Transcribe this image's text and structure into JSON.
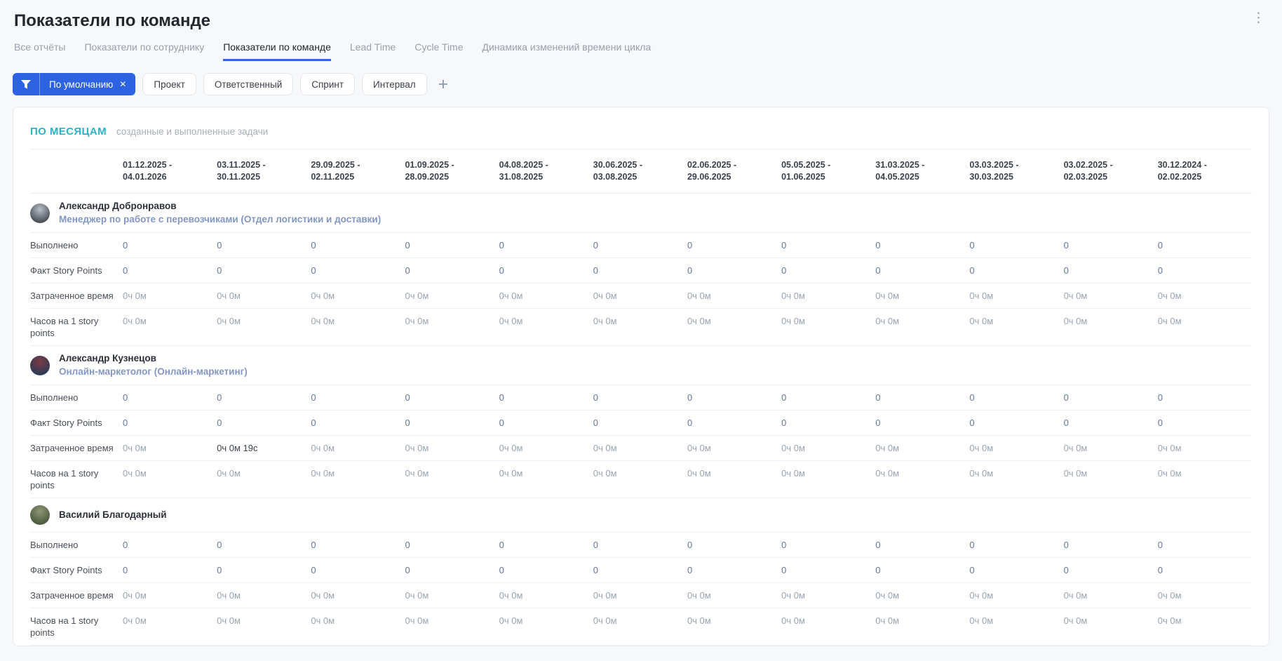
{
  "colors": {
    "accent_blue": "#2d63e2",
    "section_teal": "#2ab3c3"
  },
  "page": {
    "title": "Показатели по команде",
    "kebab_icon": "⋮"
  },
  "tabs": [
    {
      "label": "Все отчёты",
      "active": false
    },
    {
      "label": "Показатели по сотруднику",
      "active": false
    },
    {
      "label": "Показатели по команде",
      "active": true
    },
    {
      "label": "Lead Time",
      "active": false
    },
    {
      "label": "Cycle Time",
      "active": false
    },
    {
      "label": "Динамика изменений времени цикла",
      "active": false
    }
  ],
  "filters": {
    "active_filter": {
      "label": "По умолчанию",
      "close_icon": "✕",
      "icon": "funnel-icon"
    },
    "buttons": [
      "Проект",
      "Ответственный",
      "Спринт",
      "Интервал"
    ],
    "add_icon": "+"
  },
  "report": {
    "section_title": "ПО МЕСЯЦАМ",
    "section_subtitle": "созданные и выполненные задачи",
    "columns": [
      "01.12.2025 - 04.01.2026",
      "03.11.2025 - 30.11.2025",
      "29.09.2025 - 02.11.2025",
      "01.09.2025 - 28.09.2025",
      "04.08.2025 - 31.08.2025",
      "30.06.2025 - 03.08.2025",
      "02.06.2025 - 29.06.2025",
      "05.05.2025 - 01.06.2025",
      "31.03.2025 - 04.05.2025",
      "03.03.2025 - 30.03.2025",
      "03.02.2025 - 02.03.2025",
      "30.12.2024 - 02.02.2025"
    ],
    "metrics": [
      "Выполнено",
      "Факт Story Points",
      "Затраченное время",
      "Часов на 1 story points"
    ],
    "employees": [
      {
        "name": "Александр Добронравов",
        "role": "Менеджер по работе с перевозчиками (Отдел логистики и доставки)",
        "avatar": {
          "c1": "#b9bec6",
          "c2": "#4a4f58"
        },
        "values": [
          [
            "0",
            "0",
            "0",
            "0",
            "0",
            "0",
            "0",
            "0",
            "0",
            "0",
            "0",
            "0"
          ],
          [
            "0",
            "0",
            "0",
            "0",
            "0",
            "0",
            "0",
            "0",
            "0",
            "0",
            "0",
            "0"
          ],
          [
            "0ч 0м",
            "0ч 0м",
            "0ч 0м",
            "0ч 0м",
            "0ч 0м",
            "0ч 0м",
            "0ч 0м",
            "0ч 0м",
            "0ч 0м",
            "0ч 0м",
            "0ч 0м",
            "0ч 0м"
          ],
          [
            "0ч 0м",
            "0ч 0м",
            "0ч 0м",
            "0ч 0м",
            "0ч 0м",
            "0ч 0м",
            "0ч 0м",
            "0ч 0м",
            "0ч 0м",
            "0ч 0м",
            "0ч 0м",
            "0ч 0м"
          ]
        ]
      },
      {
        "name": "Александр Кузнецов",
        "role": "Онлайн-маркетолог (Онлайн-маркетинг)",
        "avatar": {
          "c1": "#7d3b45",
          "c2": "#2e3a55"
        },
        "values": [
          [
            "0",
            "0",
            "0",
            "0",
            "0",
            "0",
            "0",
            "0",
            "0",
            "0",
            "0",
            "0"
          ],
          [
            "0",
            "0",
            "0",
            "0",
            "0",
            "0",
            "0",
            "0",
            "0",
            "0",
            "0",
            "0"
          ],
          [
            "0ч 0м",
            "0ч 0м 19с",
            "0ч 0м",
            "0ч 0м",
            "0ч 0м",
            "0ч 0м",
            "0ч 0м",
            "0ч 0м",
            "0ч 0м",
            "0ч 0м",
            "0ч 0м",
            "0ч 0м"
          ],
          [
            "0ч 0м",
            "0ч 0м",
            "0ч 0м",
            "0ч 0м",
            "0ч 0м",
            "0ч 0м",
            "0ч 0м",
            "0ч 0м",
            "0ч 0м",
            "0ч 0м",
            "0ч 0м",
            "0ч 0м"
          ]
        ]
      },
      {
        "name": "Василий Благодарный",
        "role": "",
        "avatar": {
          "c1": "#8f9675",
          "c2": "#4e5a3e"
        },
        "values": [
          [
            "0",
            "0",
            "0",
            "0",
            "0",
            "0",
            "0",
            "0",
            "0",
            "0",
            "0",
            "0"
          ],
          [
            "0",
            "0",
            "0",
            "0",
            "0",
            "0",
            "0",
            "0",
            "0",
            "0",
            "0",
            "0"
          ],
          [
            "0ч 0м",
            "0ч 0м",
            "0ч 0м",
            "0ч 0м",
            "0ч 0м",
            "0ч 0м",
            "0ч 0м",
            "0ч 0м",
            "0ч 0м",
            "0ч 0м",
            "0ч 0м",
            "0ч 0м"
          ],
          [
            "0ч 0м",
            "0ч 0м",
            "0ч 0м",
            "0ч 0м",
            "0ч 0м",
            "0ч 0м",
            "0ч 0м",
            "0ч 0м",
            "0ч 0м",
            "0ч 0м",
            "0ч 0м",
            "0ч 0м"
          ]
        ]
      }
    ]
  }
}
